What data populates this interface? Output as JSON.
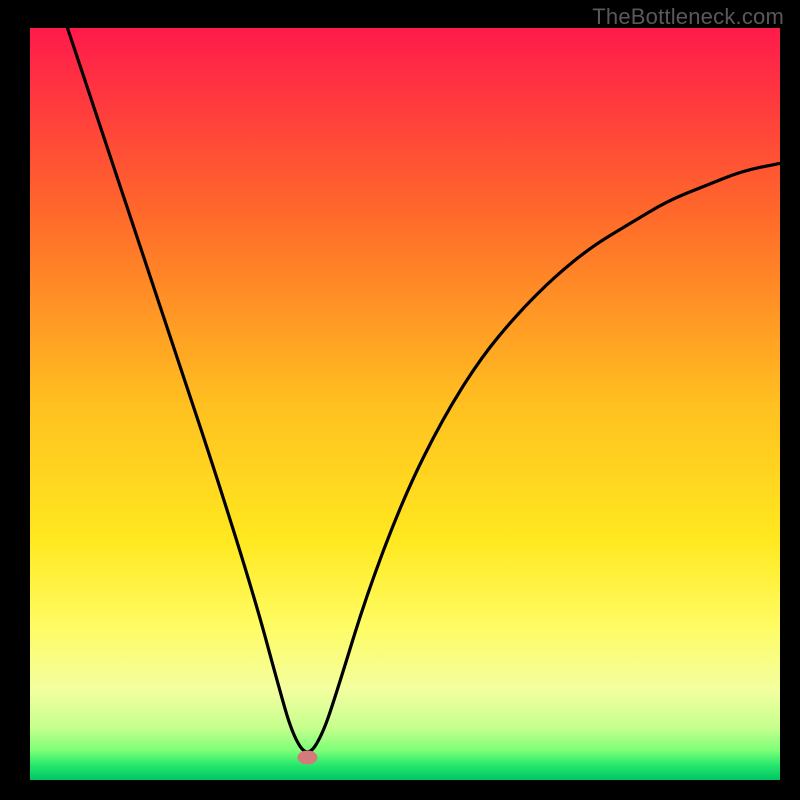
{
  "watermark": "TheBottleneck.com",
  "chart_data": {
    "type": "line",
    "title": "",
    "xlabel": "",
    "ylabel": "",
    "xlim": [
      0,
      100
    ],
    "ylim": [
      0,
      100
    ],
    "optimum_x": 37,
    "notes": "V-shaped bottleneck curve over a vertical red→orange→yellow→green gradient; black curve plunges from top-left to a minimum near x≈37, y≈3 (pink marker), then rises with decreasing slope toward upper-right.",
    "gradient_stops": [
      {
        "offset": 0,
        "color": "#ff1a4b"
      },
      {
        "offset": 25,
        "color": "#ff6a2a"
      },
      {
        "offset": 50,
        "color": "#ffc020"
      },
      {
        "offset": 68,
        "color": "#ffe81f"
      },
      {
        "offset": 79,
        "color": "#fffb60"
      },
      {
        "offset": 88,
        "color": "#f3ffa0"
      },
      {
        "offset": 93,
        "color": "#c6ff8e"
      },
      {
        "offset": 96,
        "color": "#7fff78"
      },
      {
        "offset": 98,
        "color": "#27e86b"
      },
      {
        "offset": 100,
        "color": "#00c566"
      }
    ],
    "curve_points": [
      {
        "x": 5,
        "y": 100
      },
      {
        "x": 10,
        "y": 85
      },
      {
        "x": 15,
        "y": 70
      },
      {
        "x": 20,
        "y": 55
      },
      {
        "x": 25,
        "y": 40
      },
      {
        "x": 30,
        "y": 24
      },
      {
        "x": 33,
        "y": 13
      },
      {
        "x": 35,
        "y": 6
      },
      {
        "x": 37,
        "y": 3
      },
      {
        "x": 39,
        "y": 6
      },
      {
        "x": 41,
        "y": 12
      },
      {
        "x": 45,
        "y": 25
      },
      {
        "x": 50,
        "y": 38
      },
      {
        "x": 55,
        "y": 48
      },
      {
        "x": 60,
        "y": 56
      },
      {
        "x": 65,
        "y": 62
      },
      {
        "x": 70,
        "y": 67
      },
      {
        "x": 75,
        "y": 71
      },
      {
        "x": 80,
        "y": 74
      },
      {
        "x": 85,
        "y": 77
      },
      {
        "x": 90,
        "y": 79
      },
      {
        "x": 95,
        "y": 81
      },
      {
        "x": 100,
        "y": 82
      }
    ],
    "marker": {
      "x": 37,
      "y": 3,
      "color": "#d47a7a"
    }
  }
}
